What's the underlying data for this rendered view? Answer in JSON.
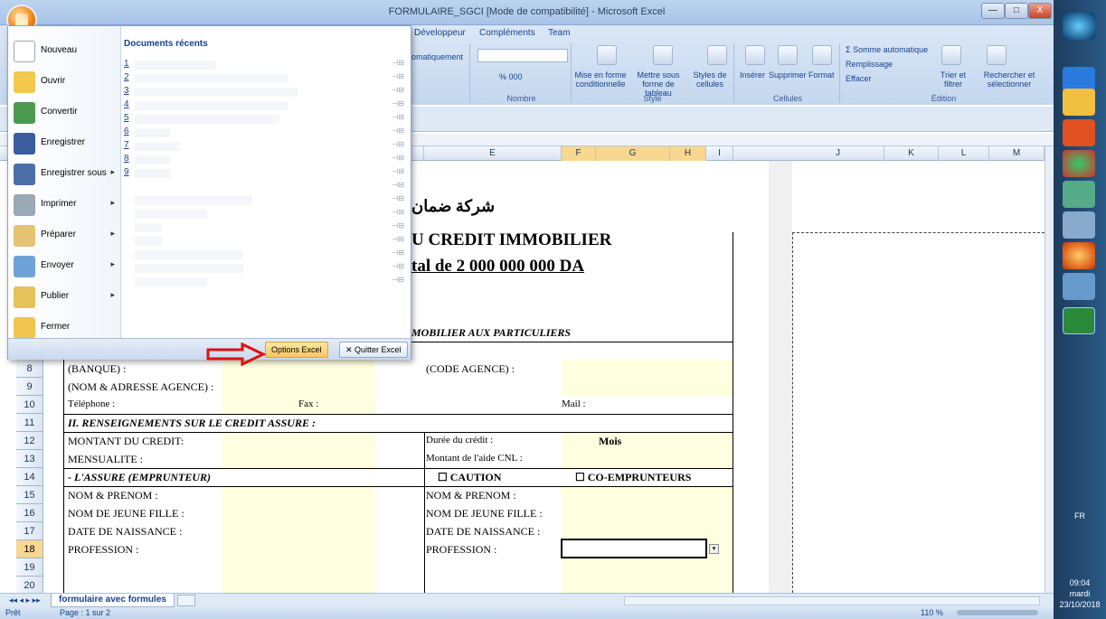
{
  "window": {
    "title": "FORMULAIRE_SGCI [Mode de compatibilité] - Microsoft Excel",
    "minimize": "—",
    "maximize": "□",
    "close": "X"
  },
  "ribbon": {
    "tabs": [
      "Développeur",
      "Compléments",
      "Team"
    ],
    "partial_label": "omatiquement",
    "number_group": {
      "label": "Nombre",
      "fmt": "% 000"
    },
    "style_group": {
      "label": "Style",
      "items": [
        "Mise en forme conditionnelle",
        "Mettre sous forme de tableau",
        "Styles de cellules"
      ]
    },
    "cells_group": {
      "label": "Cellules",
      "items": [
        "Insérer",
        "Supprimer",
        "Format"
      ]
    },
    "edit_group": {
      "label": "Édition",
      "items": [
        "Σ Somme automatique",
        "Remplissage",
        "Effacer",
        "Trier et filtrer",
        "Rechercher et sélectionner"
      ]
    }
  },
  "columns": {
    "left": [
      "11",
      "12",
      "13",
      "14",
      "15",
      "16",
      "17",
      "18",
      "19",
      "20"
    ],
    "letters": [
      "E",
      "F",
      "G",
      "H",
      "I",
      "J",
      "K",
      "L",
      "M"
    ]
  },
  "menu": {
    "items": [
      {
        "label": "Nouveau",
        "arrow": false
      },
      {
        "label": "Ouvrir",
        "arrow": false
      },
      {
        "label": "Convertir",
        "arrow": false
      },
      {
        "label": "Enregistrer",
        "arrow": false
      },
      {
        "label": "Enregistrer sous",
        "arrow": true
      },
      {
        "label": "Imprimer",
        "arrow": true
      },
      {
        "label": "Préparer",
        "arrow": true
      },
      {
        "label": "Envoyer",
        "arrow": true
      },
      {
        "label": "Publier",
        "arrow": true
      },
      {
        "label": "Fermer",
        "arrow": false
      }
    ],
    "recent_title": "Documents récents",
    "recent": [
      "1",
      "2",
      "3",
      "4",
      "5",
      "6",
      "7",
      "8",
      "9",
      "",
      "",
      "",
      "",
      "",
      "",
      "",
      ""
    ],
    "options_btn": "Options Excel",
    "quit_btn": "Quitter Excel"
  },
  "sheet": {
    "arabic": "شركة ضمان",
    "title1": "U CREDIT IMMOBILIER",
    "title2": "tal de 2 000 000 000    DA",
    "section1": "MOBILIER AUX PARTICULIERS",
    "rows": [
      "8",
      "9",
      "10",
      "11",
      "12",
      "13",
      "14",
      "15",
      "16",
      "17",
      "18",
      "19",
      "20"
    ],
    "r8a": "(BANQUE) :",
    "r8b": "(CODE AGENCE) :",
    "r9a": "(NOM & ADRESSE AGENCE) :",
    "r10a": "Téléphone :",
    "r10b": "Fax :",
    "r10c": "Mail :",
    "r11": "II.  RENSEIGNEMENTS SUR LE CREDIT ASSURE :",
    "r12a": "MONTANT DU CREDIT:",
    "r12b": "Durée du crédit :",
    "r12c": "Mois",
    "r13a": "MENSUALITE :",
    "r13b": "Montant de l'aide CNL :",
    "r14a": "-  L'ASSURE (EMPRUNTEUR)",
    "r14b": "☐ CAUTION",
    "r14c": "☐ CO-EMPRUNTEURS",
    "r15a": "NOM & PRENOM :",
    "r15b": "NOM & PRENOM :",
    "r16a": "NOM DE JEUNE FILLE :",
    "r16b": "NOM DE JEUNE FILLE :",
    "r17a": "DATE DE NAISSANCE :",
    "r17b": "DATE DE NAISSANCE :",
    "r18a": "PROFESSION :",
    "r18b": "PROFESSION :"
  },
  "sheet_tab": "formulaire avec formules",
  "status": {
    "ready": "Prêt",
    "page": "Page : 1 sur 2",
    "zoom": "110 %"
  },
  "taskbar": {
    "lang": "FR",
    "time": "09:04",
    "day": "mardi",
    "date": "23/10/2018"
  }
}
